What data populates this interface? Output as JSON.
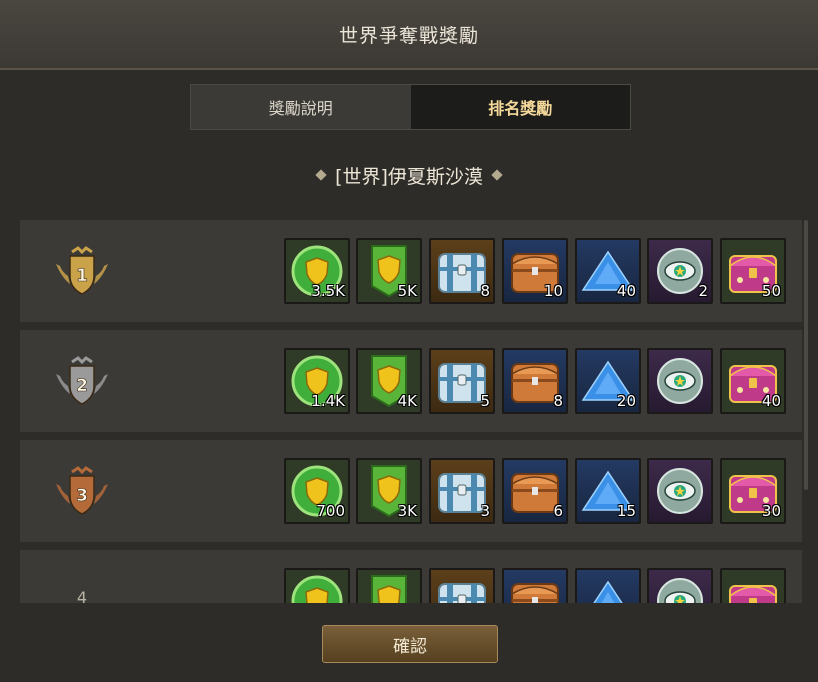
{
  "window": {
    "title": "世界爭奪戰獎勵"
  },
  "tabs": [
    {
      "label": "獎勵說明",
      "active": false
    },
    {
      "label": "排名獎勵",
      "active": true
    }
  ],
  "region": {
    "label": "[世界]伊夏斯沙漠"
  },
  "reward_types": [
    "green-coin-shield",
    "green-shield-banner",
    "silver-chest",
    "copper-chest",
    "blue-crystal",
    "eye-orb",
    "pink-jewel-chest"
  ],
  "rows": [
    {
      "rank": "1",
      "badge_color": "#c9a24a",
      "amounts": [
        "3.5K",
        "5K",
        "8",
        "10",
        "40",
        "2",
        "50"
      ]
    },
    {
      "rank": "2",
      "badge_color": "#9a9a9a",
      "amounts": [
        "1.4K",
        "4K",
        "5",
        "8",
        "20",
        "",
        "40"
      ]
    },
    {
      "rank": "3",
      "badge_color": "#b56a3a",
      "amounts": [
        "700",
        "3K",
        "3",
        "6",
        "15",
        "",
        "30"
      ]
    },
    {
      "rank": "4",
      "badge_color": "",
      "amounts": [
        "",
        "",
        "",
        "",
        "",
        "",
        ""
      ]
    }
  ],
  "footer": {
    "confirm_label": "確認"
  }
}
